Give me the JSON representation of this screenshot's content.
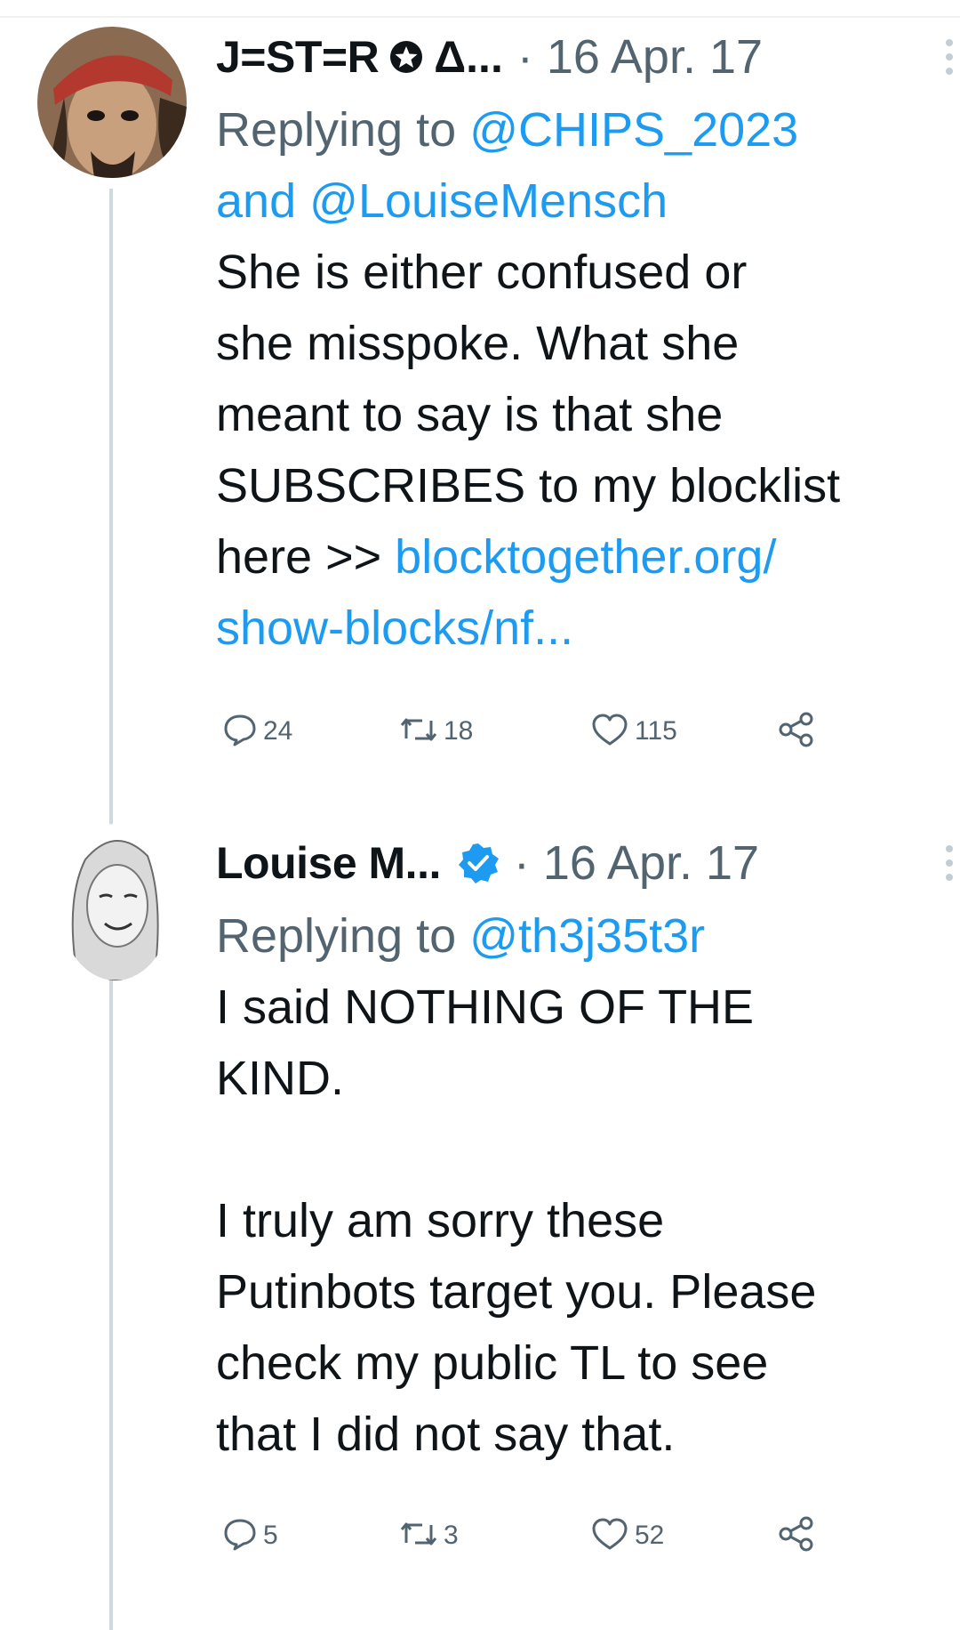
{
  "tweets": [
    {
      "name": "J=ST=R",
      "name_trunc": "Δ...",
      "date": "· 16 Apr. 17",
      "reply_prefix": "Replying to",
      "reply_mention_1": "@CHIPS_2023",
      "reply_and": "and",
      "reply_mention_2": "@LouiseMensch",
      "text_lines": [
        "She is either confused or",
        "she misspoke. What she",
        "meant to say is that she",
        "SUBSCRIBES to my blocklist"
      ],
      "text_here": "here >> ",
      "link_line_1": "blocktogether.org/",
      "link_line_2": "show-blocks/nf...",
      "replies": "24",
      "retweets": "18",
      "likes": "115"
    },
    {
      "name": "Louise M...",
      "date": "· 16 Apr. 17",
      "reply_prefix": "Replying to",
      "reply_mention_1": "@th3j35t3r",
      "text_lines": [
        "I said NOTHING OF THE",
        "KIND.",
        "",
        "I truly am sorry these",
        "Putinbots target you. Please",
        "check my public TL to see",
        "that I did not say that."
      ],
      "replies": "5",
      "retweets": "3",
      "likes": "52"
    }
  ],
  "colors": {
    "accent": "#1d9bf0",
    "secondary": "#536471",
    "thread_line": "#cfd9de"
  },
  "icons": [
    "reply-icon",
    "retweet-icon",
    "like-icon",
    "share-icon",
    "more-icon",
    "verified-icon",
    "star-badge-icon"
  ]
}
